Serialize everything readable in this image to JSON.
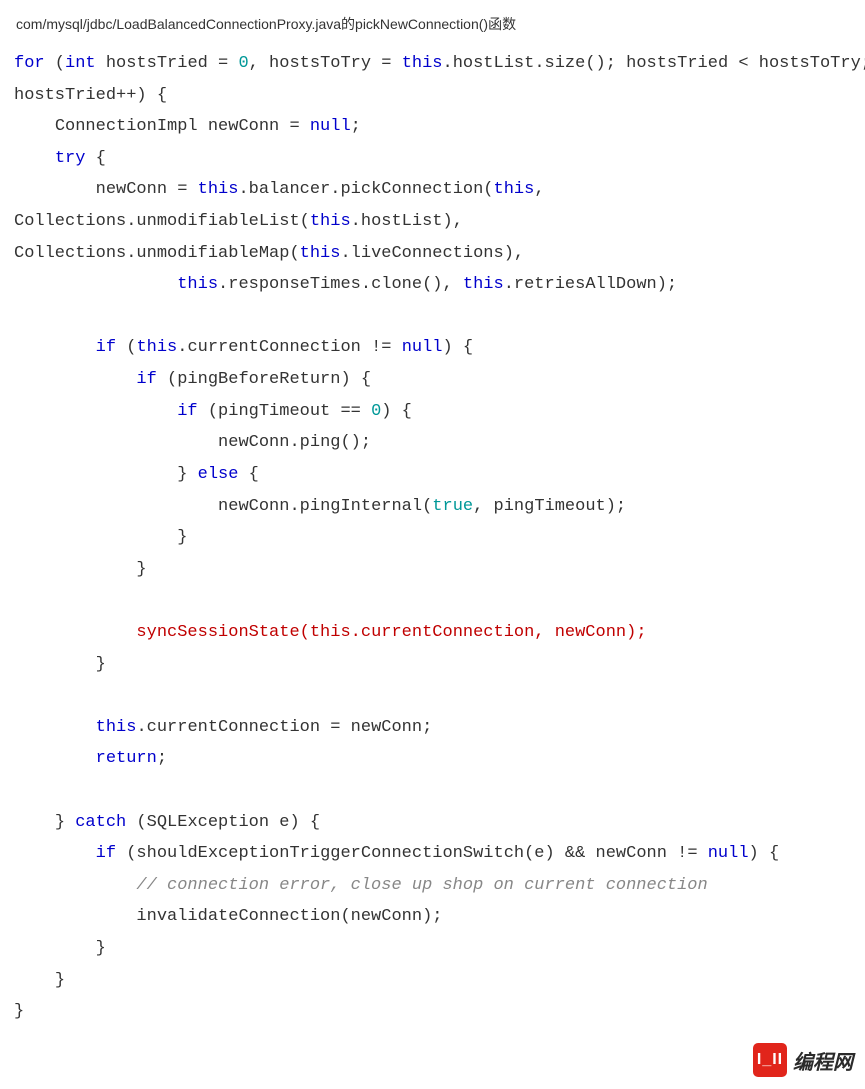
{
  "path_line": "com/mysql/jdbc/LoadBalancedConnectionProxy.java的pickNewConnection()函数",
  "code": {
    "tokens": [
      {
        "t": "kw",
        "v": "for"
      },
      {
        "t": "p",
        "v": " ("
      },
      {
        "t": "kw",
        "v": "int"
      },
      {
        "t": "p",
        "v": " hostsTried = "
      },
      {
        "t": "num",
        "v": "0"
      },
      {
        "t": "p",
        "v": ", hostsToTry = "
      },
      {
        "t": "kw",
        "v": "this"
      },
      {
        "t": "p",
        "v": ".hostList.size(); hostsTried < hostsToTry; hostsTried++) {\n"
      },
      {
        "t": "p",
        "v": "    ConnectionImpl newConn = "
      },
      {
        "t": "kw",
        "v": "null"
      },
      {
        "t": "p",
        "v": ";\n"
      },
      {
        "t": "p",
        "v": "    "
      },
      {
        "t": "kw",
        "v": "try"
      },
      {
        "t": "p",
        "v": " {\n"
      },
      {
        "t": "p",
        "v": "        newConn = "
      },
      {
        "t": "kw",
        "v": "this"
      },
      {
        "t": "p",
        "v": ".balancer.pickConnection("
      },
      {
        "t": "kw",
        "v": "this"
      },
      {
        "t": "p",
        "v": ", Collections.unmodifiableList("
      },
      {
        "t": "kw",
        "v": "this"
      },
      {
        "t": "p",
        "v": ".hostList), Collections.unmodifiableMap("
      },
      {
        "t": "kw",
        "v": "this"
      },
      {
        "t": "p",
        "v": ".liveConnections),\n"
      },
      {
        "t": "p",
        "v": "                "
      },
      {
        "t": "kw",
        "v": "this"
      },
      {
        "t": "p",
        "v": ".responseTimes.clone(), "
      },
      {
        "t": "kw",
        "v": "this"
      },
      {
        "t": "p",
        "v": ".retriesAllDown);\n"
      },
      {
        "t": "p",
        "v": "\n"
      },
      {
        "t": "p",
        "v": "        "
      },
      {
        "t": "kw",
        "v": "if"
      },
      {
        "t": "p",
        "v": " ("
      },
      {
        "t": "kw",
        "v": "this"
      },
      {
        "t": "p",
        "v": ".currentConnection != "
      },
      {
        "t": "kw",
        "v": "null"
      },
      {
        "t": "p",
        "v": ") {\n"
      },
      {
        "t": "p",
        "v": "            "
      },
      {
        "t": "kw",
        "v": "if"
      },
      {
        "t": "p",
        "v": " (pingBeforeReturn) {\n"
      },
      {
        "t": "p",
        "v": "                "
      },
      {
        "t": "kw",
        "v": "if"
      },
      {
        "t": "p",
        "v": " (pingTimeout == "
      },
      {
        "t": "num",
        "v": "0"
      },
      {
        "t": "p",
        "v": ") {\n"
      },
      {
        "t": "p",
        "v": "                    newConn.ping();\n"
      },
      {
        "t": "p",
        "v": "                } "
      },
      {
        "t": "kw",
        "v": "else"
      },
      {
        "t": "p",
        "v": " {\n"
      },
      {
        "t": "p",
        "v": "                    newConn.pingInternal("
      },
      {
        "t": "num",
        "v": "true"
      },
      {
        "t": "p",
        "v": ", pingTimeout);\n"
      },
      {
        "t": "p",
        "v": "                }\n"
      },
      {
        "t": "p",
        "v": "            }\n"
      },
      {
        "t": "p",
        "v": "\n"
      },
      {
        "t": "p",
        "v": "            "
      },
      {
        "t": "hl",
        "v": "syncSessionState("
      },
      {
        "t": "hl",
        "v": "this"
      },
      {
        "t": "hl",
        "v": ".currentConnection, newConn);"
      },
      {
        "t": "p",
        "v": "\n"
      },
      {
        "t": "p",
        "v": "        }\n"
      },
      {
        "t": "p",
        "v": "\n"
      },
      {
        "t": "p",
        "v": "        "
      },
      {
        "t": "kw",
        "v": "this"
      },
      {
        "t": "p",
        "v": ".currentConnection = newConn;\n"
      },
      {
        "t": "p",
        "v": "        "
      },
      {
        "t": "kw",
        "v": "return"
      },
      {
        "t": "p",
        "v": ";\n"
      },
      {
        "t": "p",
        "v": "\n"
      },
      {
        "t": "p",
        "v": "    } "
      },
      {
        "t": "kw",
        "v": "catch"
      },
      {
        "t": "p",
        "v": " (SQLException e) {\n"
      },
      {
        "t": "p",
        "v": "        "
      },
      {
        "t": "kw",
        "v": "if"
      },
      {
        "t": "p",
        "v": " (shouldExceptionTriggerConnectionSwitch(e) && newConn != "
      },
      {
        "t": "kw",
        "v": "null"
      },
      {
        "t": "p",
        "v": ") {\n"
      },
      {
        "t": "p",
        "v": "            "
      },
      {
        "t": "cmnt",
        "v": "// connection error, close up shop on current connection"
      },
      {
        "t": "p",
        "v": "\n"
      },
      {
        "t": "p",
        "v": "            invalidateConnection(newConn);\n"
      },
      {
        "t": "p",
        "v": "        }\n"
      },
      {
        "t": "p",
        "v": "    }\n"
      },
      {
        "t": "p",
        "v": "}"
      }
    ]
  },
  "watermark": {
    "badge": "I_II",
    "text": "编程网"
  }
}
